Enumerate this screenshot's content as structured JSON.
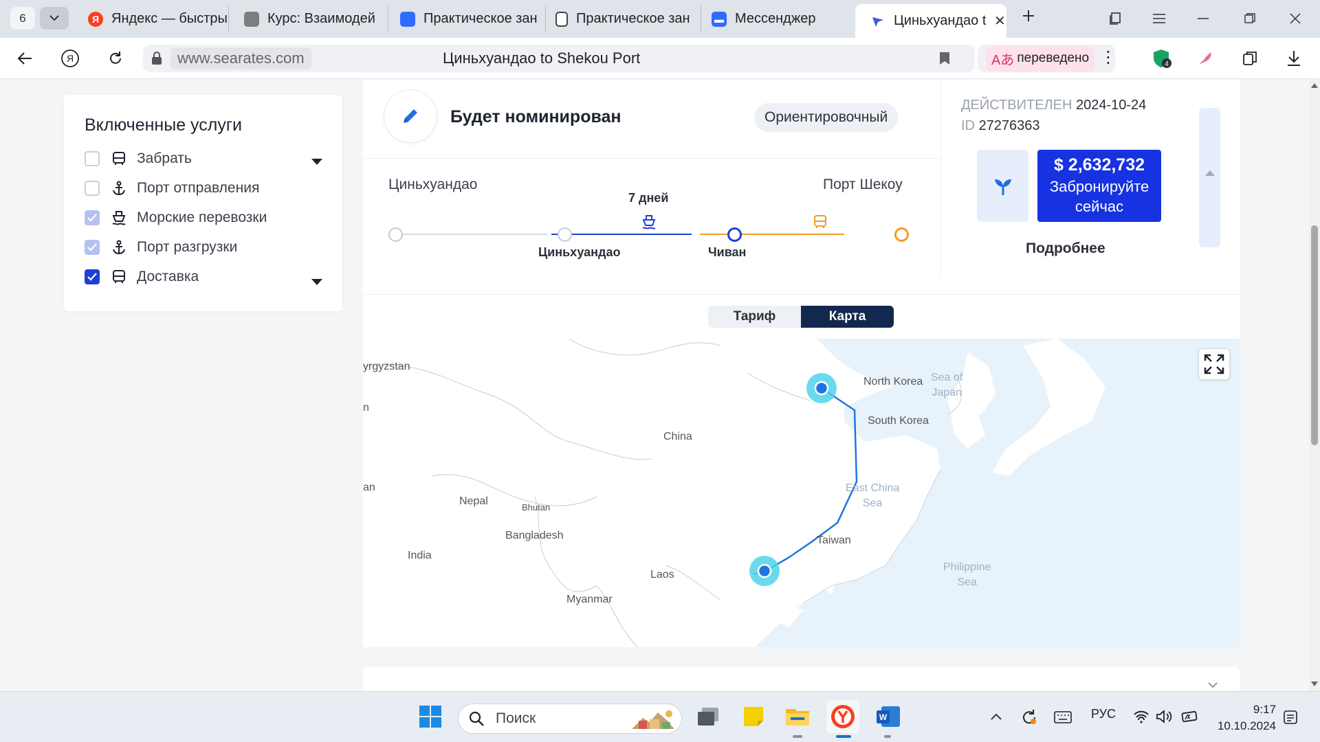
{
  "browser": {
    "tab_count": "6",
    "tabs": [
      {
        "title": "Яндекс — быстры",
        "icon": "yandex-icon",
        "color": "#fc3f1d"
      },
      {
        "title": "Курс: Взаимодей",
        "icon": "course-icon",
        "color": "#555555"
      },
      {
        "title": "Практическое зан",
        "icon": "cube-icon",
        "color": "#2f6bff"
      },
      {
        "title": "Практическое зан",
        "icon": "document-icon",
        "color": "#444444"
      },
      {
        "title": "Мессенджер",
        "icon": "messenger-icon",
        "color": "#2f6bff"
      },
      {
        "title": "Циньхуандао t",
        "icon": "searates-icon",
        "color": "#3b5bdb"
      }
    ],
    "url_host": "www.searates.com",
    "page_title": "Циньхуандао to Shekou Port",
    "translated_label": "переведено",
    "extension_badge": "4"
  },
  "services": {
    "title": "Включенные услуги",
    "items": [
      {
        "label": "Забрать",
        "state": "unchecked",
        "icon": "truck-icon",
        "dropdown": true
      },
      {
        "label": "Порт отправления",
        "state": "unchecked",
        "icon": "anchor-icon",
        "dropdown": false
      },
      {
        "label": "Морские перевозки",
        "state": "locked",
        "icon": "ship-icon",
        "dropdown": false
      },
      {
        "label": "Порт разгрузки",
        "state": "locked",
        "icon": "anchor-icon",
        "dropdown": false
      },
      {
        "label": "Доставка",
        "state": "checked",
        "icon": "truck-icon",
        "dropdown": true
      }
    ]
  },
  "quote": {
    "carrier": "Будет номинирован",
    "badge": "Ориентировочный",
    "origin_city": "Циньхуандао",
    "destination_city": "Порт Шекоу",
    "transit": "7 дней",
    "route_points": [
      "Циньхуандао",
      "Чиван"
    ],
    "valid_label": "ДЕЙСТВИТЕЛЕН",
    "valid_date": "2024-10-24",
    "id_label": "ID",
    "id_value": "27276363",
    "price": "$ 2,632,732",
    "book_label": "Забронируйте сейчас",
    "details_label": "Подробнее",
    "colors": {
      "sea": "#1f3fd6",
      "land": "#f59a23",
      "book": "#1732e0"
    }
  },
  "view_toggle": {
    "tariff": "Тариф",
    "map": "Карта",
    "active": "map"
  },
  "map": {
    "labels": {
      "kyrgyzstan": "yrgyzstan",
      "n": "n",
      "an": "an",
      "north_korea": "North Korea",
      "south_korea": "South Korea",
      "sea_of_japan": "Sea of\nJapan",
      "china": "China",
      "east_china_sea": "East China\nSea",
      "nepal": "Nepal",
      "bhutan": "Bhutan",
      "bangladesh": "Bangladesh",
      "india": "India",
      "taiwan": "Taiwan",
      "laos": "Laos",
      "philippine_sea": "Philippine\nSea",
      "myanmar": "Myanmar"
    }
  },
  "taskbar": {
    "search_placeholder": "Поиск",
    "language": "РУС",
    "time": "9:17",
    "date": "10.10.2024"
  }
}
